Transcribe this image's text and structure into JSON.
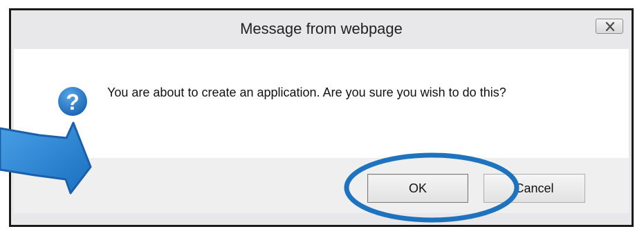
{
  "dialog": {
    "title": "Message from webpage",
    "close_icon": "close-x-icon",
    "icon": "question-icon",
    "message": "You are about to create an application. Are you sure you wish to do this?",
    "ok_label": "OK",
    "cancel_label": "Cancel"
  },
  "annotations": {
    "arrow_icon": "arrow-right-icon",
    "highlight": "ok-button-circle",
    "accent_color": "#1e73be"
  }
}
